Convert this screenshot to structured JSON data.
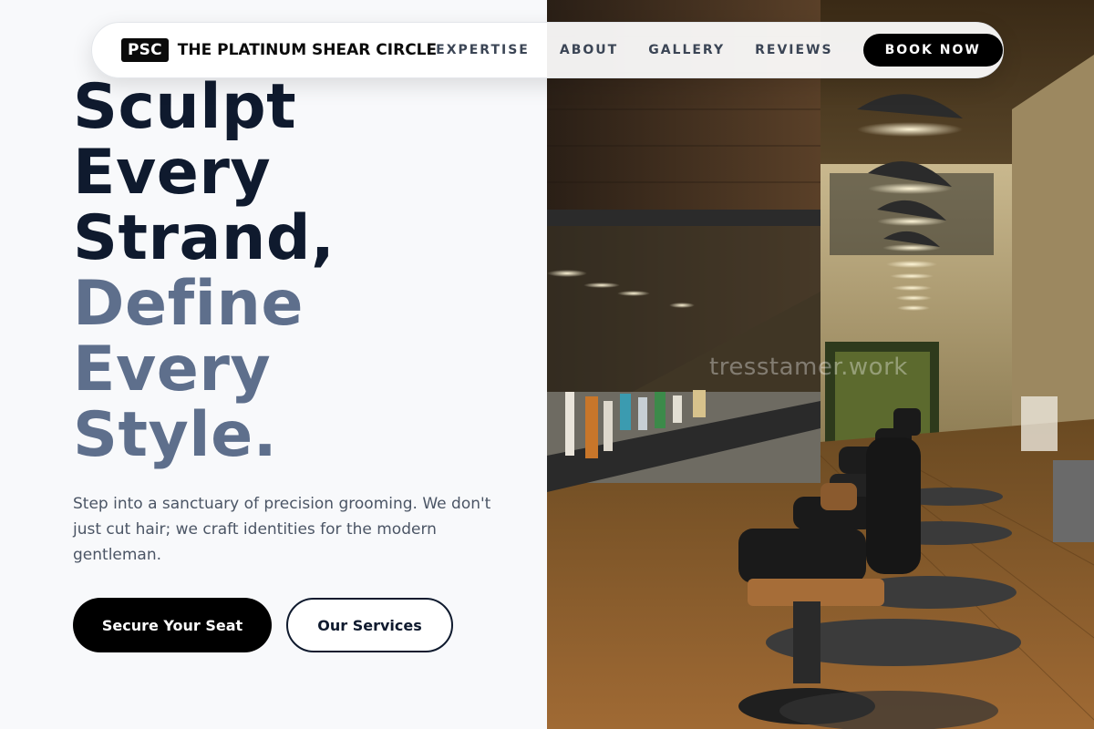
{
  "nav": {
    "logo": "PSC",
    "brand": "THE PLATINUM SHEAR CIRCLE",
    "links": [
      "EXPERTISE",
      "ABOUT",
      "GALLERY",
      "REVIEWS"
    ],
    "cta": "BOOK NOW"
  },
  "hero": {
    "title_lines_dark": [
      "Sculpt",
      "Every",
      "Strand,"
    ],
    "title_lines_muted": [
      "Define",
      "Every",
      "Style."
    ],
    "subtitle": "Step into a sanctuary of precision grooming. We don't just cut hair; we craft identities for the modern gentleman.",
    "primary_button": "Secure Your Seat",
    "secondary_button": "Our Services"
  },
  "photo": {
    "watermark": "tresstamer.work"
  },
  "colors": {
    "title_dark": "#0f1a2e",
    "title_muted": "#5e6f8c",
    "primary": "#000000"
  }
}
